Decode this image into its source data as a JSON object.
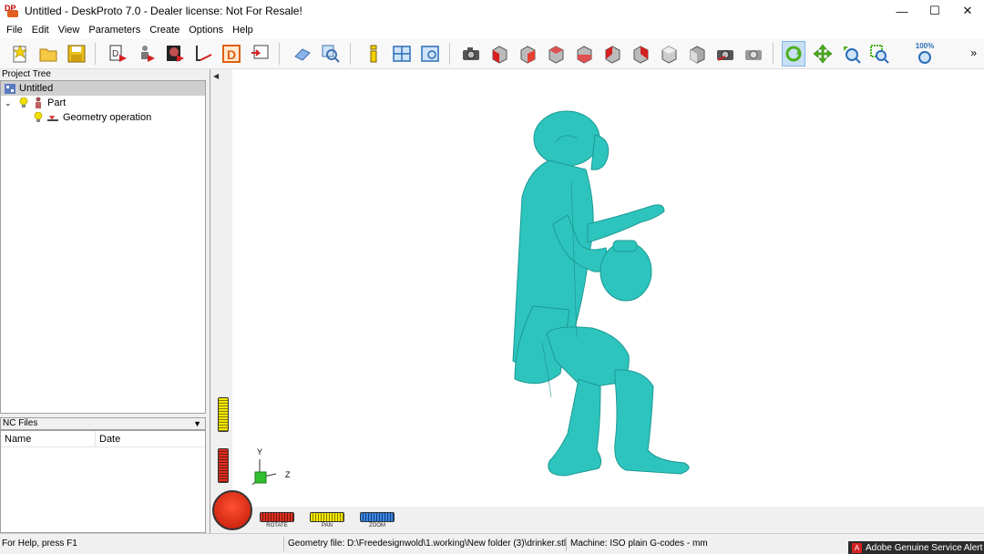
{
  "window": {
    "title": "Untitled - DeskProto 7.0 - Dealer license: Not For Resale!",
    "controls": {
      "minimize": "—",
      "maximize": "☐",
      "close": "✕"
    }
  },
  "menu": {
    "items": [
      "File",
      "Edit",
      "View",
      "Parameters",
      "Create",
      "Options",
      "Help"
    ]
  },
  "toolbar": {
    "zoom_level": "100%",
    "overflow": "»",
    "buttons": [
      "new-project",
      "open-project",
      "save-project",
      "wizard-part",
      "wizard-part-2",
      "wizard-relief",
      "wizard-image",
      "wizard-d",
      "wizard-export",
      "view-eraser",
      "view-zoom-window",
      "info",
      "view-tile",
      "view-window",
      "screenshot",
      "view-front",
      "view-back",
      "view-left",
      "view-right",
      "view-top",
      "view-bottom",
      "view-iso-1",
      "view-iso-2",
      "view-reset",
      "view-lock",
      "mode-rotate",
      "mode-pan",
      "mode-zoom",
      "zoom-window",
      "zoom-100"
    ]
  },
  "project_tree": {
    "header": "Project Tree",
    "root": "Untitled",
    "part": "Part",
    "operation": "Geometry operation"
  },
  "nc_files": {
    "header": "NC Files",
    "columns": [
      "Name",
      "Date"
    ]
  },
  "viewport": {
    "axis_y": "Y",
    "axis_z": "Z",
    "dials": {
      "rotate": "ROTATE",
      "pan": "PAN",
      "zoom": "ZOOM"
    },
    "model_color": "#2ec4be"
  },
  "status": {
    "help": "For Help, press F1",
    "geometry": "Geometry file: D:\\Freedesignwold\\1.working\\New folder (3)\\drinker.stl",
    "machine": "Machine: ISO plain G-codes - mm",
    "alert": "Adobe Genuine Service Alert",
    "alert_icon": "A"
  }
}
